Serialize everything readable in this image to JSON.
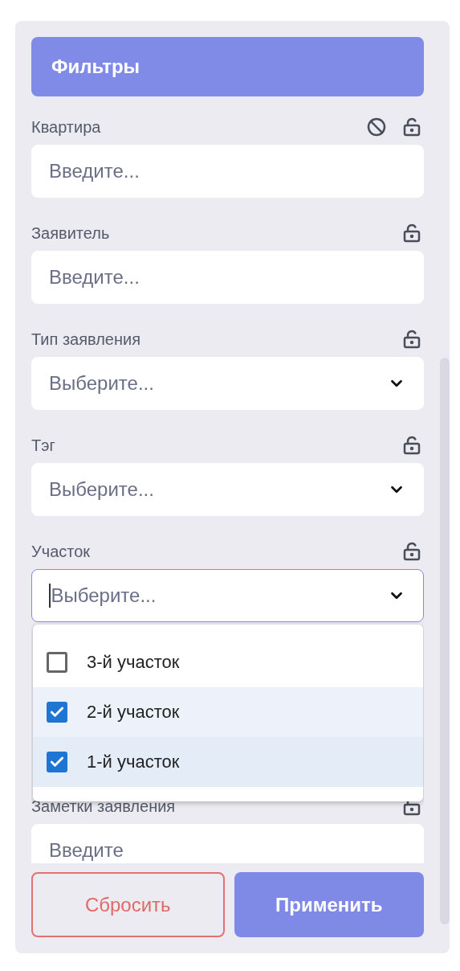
{
  "header": {
    "title": "Фильтры"
  },
  "fields": [
    {
      "label": "Квартира",
      "kind": "text",
      "placeholder": "Введите...",
      "disable_toggle": true,
      "locked": false
    },
    {
      "label": "Заявитель",
      "kind": "text",
      "placeholder": "Введите...",
      "locked": false
    },
    {
      "label": "Тип заявления",
      "kind": "select",
      "placeholder": "Выберите...",
      "locked": false
    },
    {
      "label": "Тэг",
      "kind": "select",
      "placeholder": "Выберите...",
      "locked": false
    },
    {
      "label": "Участок",
      "kind": "select",
      "placeholder": "Выберите...",
      "locked": false,
      "focused": true,
      "open": true,
      "options": [
        {
          "label": "3-й участок",
          "checked": false,
          "highlighted": false
        },
        {
          "label": "2-й участок",
          "checked": true,
          "highlighted": false
        },
        {
          "label": "1-й участок",
          "checked": true,
          "highlighted": true
        }
      ]
    },
    {
      "label": "Заметки заявления",
      "kind": "text",
      "placeholder": "Введите",
      "locked": false
    }
  ],
  "buttons": [
    {
      "label": "Сбросить",
      "kind": "outline"
    },
    {
      "label": "Применить",
      "kind": "primary"
    }
  ]
}
